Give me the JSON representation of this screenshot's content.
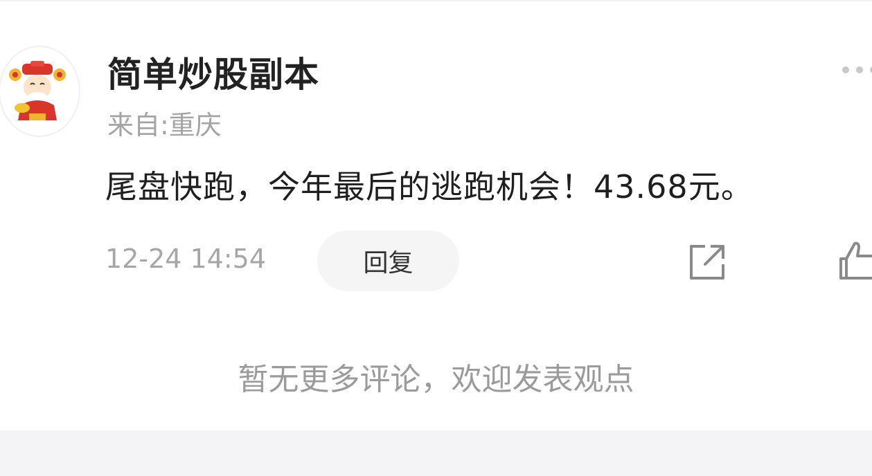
{
  "post": {
    "username": "简单炒股副本",
    "location": "来自:重庆",
    "content": "尾盘快跑，今年最后的逃跑机会！43.68元。",
    "timestamp": "12-24 14:54",
    "reply_label": "回复"
  },
  "footer": {
    "no_more_comments": "暂无更多评论，欢迎发表观点"
  },
  "icons": {
    "avatar": "cartoon-god-of-wealth-avatar",
    "more": "more-dots-icon",
    "share": "share-icon",
    "like": "thumbs-up-icon"
  },
  "colors": {
    "primary_text": "#1f1f1f",
    "secondary_text": "#a4a4a4",
    "reply_bg": "#f5f5f5",
    "section_bg": "#f4f4f6"
  }
}
